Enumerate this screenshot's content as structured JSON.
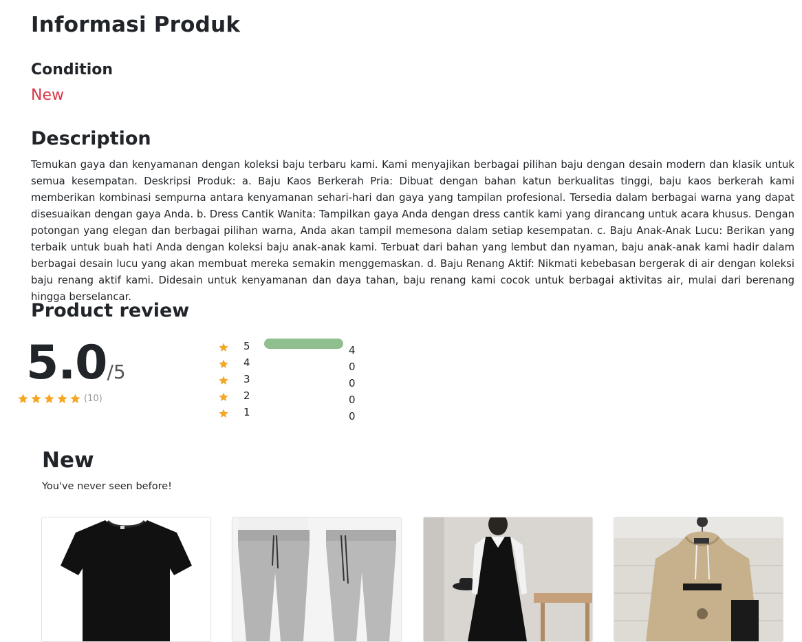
{
  "page": {
    "title": "Informasi Produk"
  },
  "condition": {
    "heading": "Condition",
    "value": "New"
  },
  "description": {
    "heading": "Description",
    "text": "Temukan gaya dan kenyamanan dengan koleksi baju terbaru kami. Kami menyajikan berbagai pilihan baju dengan desain modern dan klasik untuk semua kesempatan. Deskripsi Produk: a. Baju Kaos Berkerah Pria: Dibuat dengan bahan katun berkualitas tinggi, baju kaos berkerah kami memberikan kombinasi sempurna antara kenyamanan sehari-hari dan gaya yang tampilan profesional. Tersedia dalam berbagai warna yang dapat disesuaikan dengan gaya Anda. b. Dress Cantik Wanita: Tampilkan gaya Anda dengan dress cantik kami yang dirancang untuk acara khusus. Dengan potongan yang elegan dan berbagai pilihan warna, Anda akan tampil memesona dalam setiap kesempatan. c. Baju Anak-Anak Lucu: Berikan yang terbaik untuk buah hati Anda dengan koleksi baju anak-anak kami. Terbuat dari bahan yang lembut dan nyaman, baju anak-anak kami hadir dalam berbagai desain lucu yang akan membuat mereka semakin menggemaskan. d. Baju Renang Aktif: Nikmati kebebasan bergerak di air dengan koleksi baju renang aktif kami. Didesain untuk kenyamanan dan daya tahan, baju renang kami cocok untuk berbagai aktivitas air, mulai dari berenang hingga berselancar."
  },
  "review": {
    "heading": "Product review",
    "score": "5.0",
    "score_max": "/5",
    "overall_stars": 5,
    "total_count": "(10)",
    "star_color": "#f5a623",
    "bar_color": "#8fbf8f",
    "rows": [
      {
        "level": "5",
        "count": "4",
        "fill_fraction": 1.0
      },
      {
        "level": "4",
        "count": "0",
        "fill_fraction": 0
      },
      {
        "level": "3",
        "count": "0",
        "fill_fraction": 0
      },
      {
        "level": "2",
        "count": "0",
        "fill_fraction": 0
      },
      {
        "level": "1",
        "count": "0",
        "fill_fraction": 0
      }
    ]
  },
  "new_section": {
    "heading": "New",
    "subtitle": "You've never seen before!",
    "products": [
      {
        "image": "black-tshirt"
      },
      {
        "image": "grey-jogger-pants"
      },
      {
        "image": "black-white-dress"
      },
      {
        "image": "beige-hoodie"
      }
    ]
  }
}
